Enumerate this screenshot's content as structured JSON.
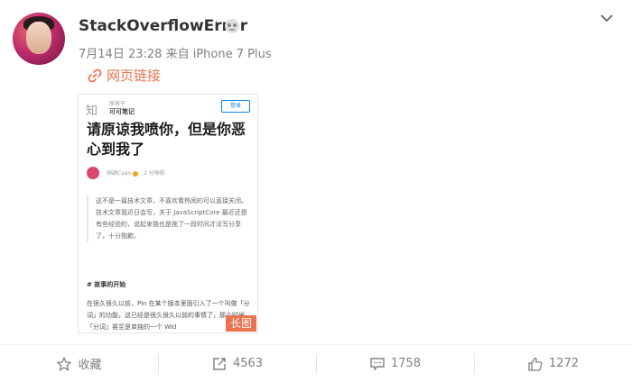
{
  "post": {
    "user_name": "StackOverflowError",
    "date": "7月14日 23:28",
    "source_prefix": "来自",
    "device": "iPhone 7 Plus",
    "link_text": "网页链接"
  },
  "card": {
    "site_logo": "知",
    "column_topic": "原发于",
    "column_name": "可可笔记",
    "login_label": "登录",
    "title": "请原谅我喷你，但是你恶心到我了",
    "author_name": "钟颖Cyan",
    "time_ago": "2 分钟前",
    "quote": "这不是一篇技术文章，不喜欢看热闹的可以直接关闭。技术文章我近日会写，关于 JavaScriptCore 最近还是有些经验的，说起来我也是拖了一段时间才没写分享了，十分抱歉。",
    "section_heading": "# 故事的开始",
    "body": "在很久很久以前，Pin 在某个版本里面引入了一个叫做「分词」的功能，这已经是很久很久以前的事情了，那个时候「分词」甚至是单独的一个 Wid",
    "badge": "长图"
  },
  "actions": {
    "favorite": "收藏",
    "repost_count": "4563",
    "comment_count": "1758",
    "like_count": "1272"
  },
  "colors": {
    "accent": "#eb7350",
    "link_blue": "#0f88eb",
    "text_gray": "#808080"
  }
}
